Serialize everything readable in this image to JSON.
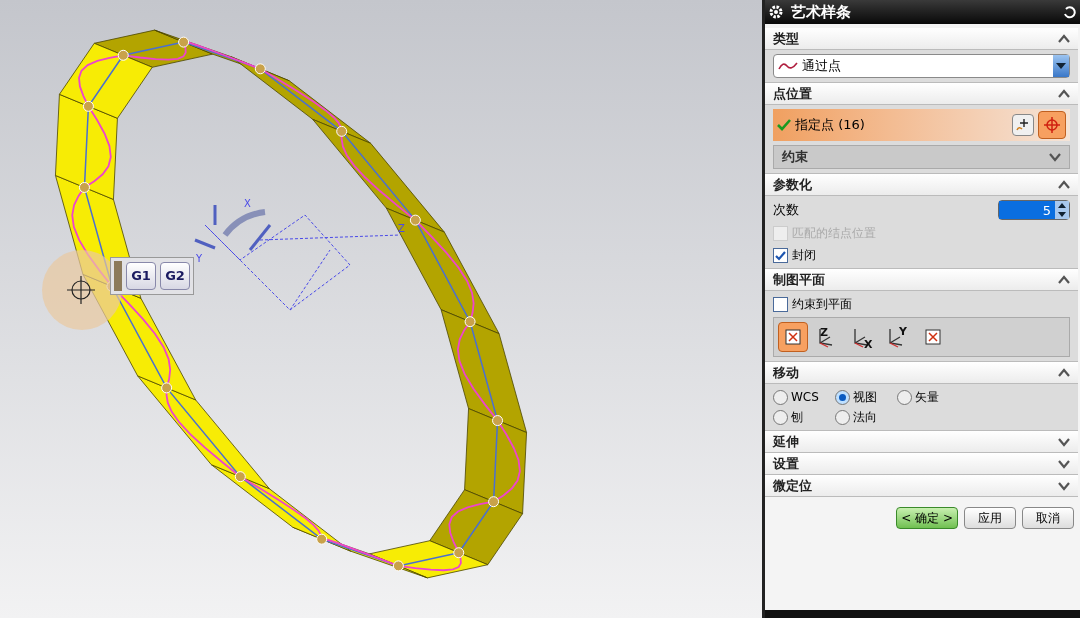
{
  "viewport": {
    "triad_labels": [
      "X",
      "Y",
      "Z"
    ],
    "snap_popup": {
      "buttons": [
        {
          "label": "G1"
        },
        {
          "label": "G2"
        }
      ]
    }
  },
  "dialog": {
    "title": "艺术样条",
    "sections": [
      {
        "kind": "type",
        "title": "类型",
        "expanded": true,
        "dropdown": {
          "value": "通过点"
        }
      },
      {
        "kind": "points",
        "title": "点位置",
        "expanded": true,
        "selector": {
          "label": "指定点 (16)",
          "selected": true
        },
        "subgroup": {
          "title": "约束",
          "expanded": false
        }
      },
      {
        "kind": "params",
        "title": "参数化",
        "expanded": true,
        "degree": {
          "label": "次数",
          "value": "5"
        },
        "checks": [
          {
            "label": "匹配的结点位置",
            "checked": false,
            "disabled": true
          },
          {
            "label": "封闭",
            "checked": true,
            "disabled": false
          }
        ]
      },
      {
        "kind": "plane",
        "title": "制图平面",
        "expanded": true,
        "checks": [
          {
            "label": "约束到平面",
            "checked": false,
            "disabled": false
          }
        ],
        "tools": [
          {
            "selected": true
          },
          {
            "axis": "Z",
            "selected": false
          },
          {
            "axis": "X",
            "selected": false
          },
          {
            "axis": "Y",
            "selected": false
          },
          {
            "selected": false
          }
        ]
      },
      {
        "kind": "move",
        "title": "移动",
        "expanded": true,
        "radios": [
          {
            "label": "WCS",
            "selected": false
          },
          {
            "label": "视图",
            "selected": true
          },
          {
            "label": "矢量",
            "selected": false
          },
          {
            "label": "刨",
            "selected": false
          },
          {
            "label": "法向",
            "selected": false
          }
        ]
      },
      {
        "title": "延伸",
        "expanded": false
      },
      {
        "title": "设置",
        "expanded": false
      },
      {
        "title": "微定位",
        "expanded": false
      }
    ],
    "buttons": [
      {
        "label": "< 确定 >",
        "default": true
      },
      {
        "label": "应用",
        "default": false
      },
      {
        "label": "取消",
        "default": false
      }
    ]
  }
}
